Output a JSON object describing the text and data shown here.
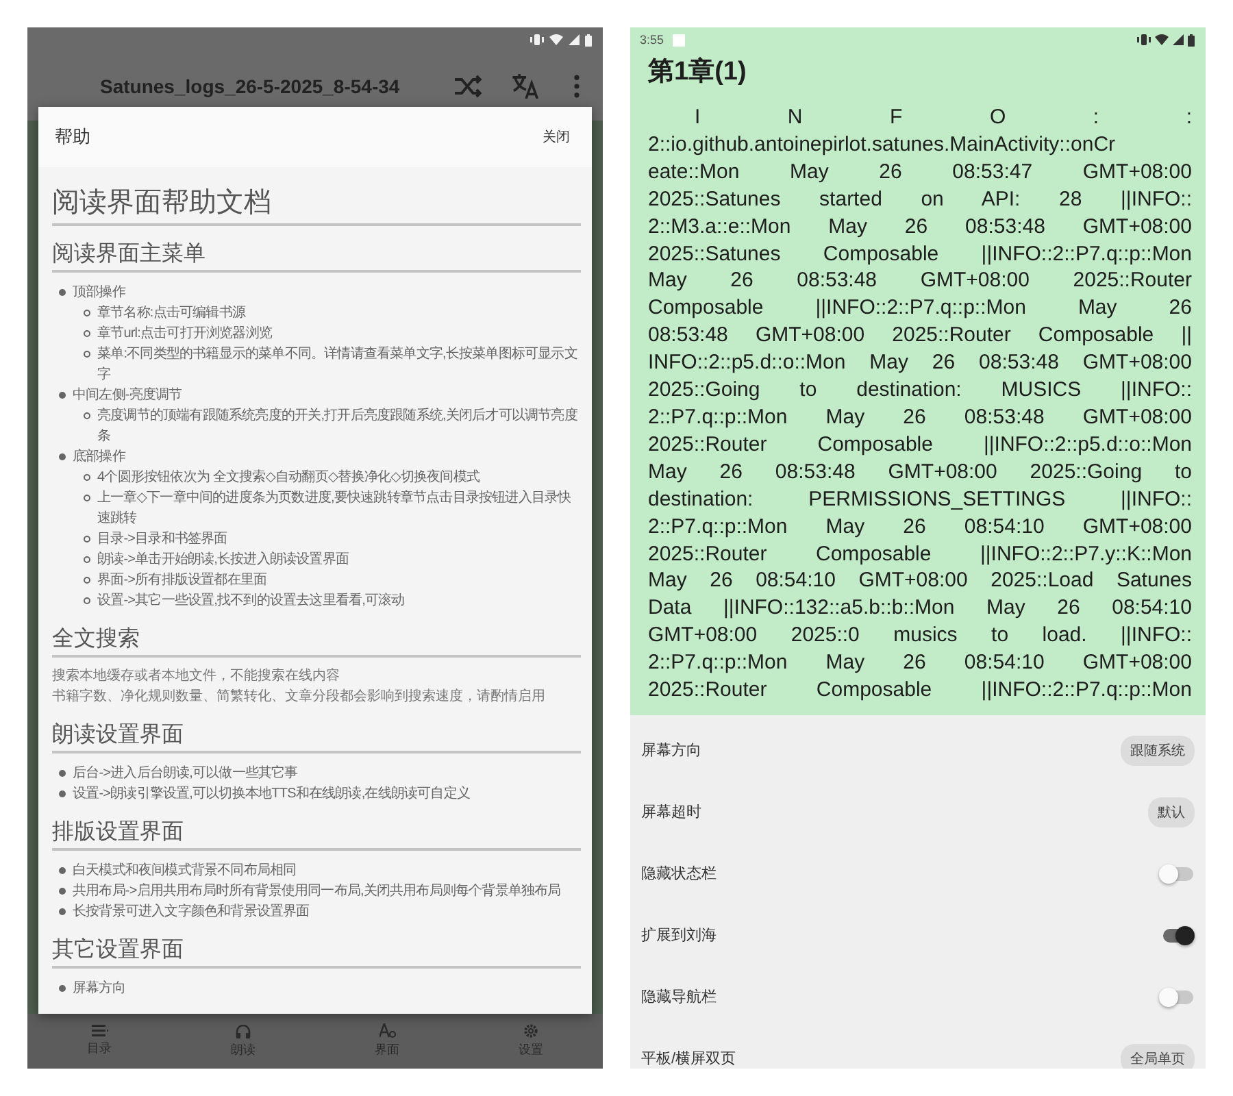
{
  "left_screen": {
    "toolbar": {
      "title": "Satunes_logs_26-5-2025_8-54-34"
    },
    "help_dialog": {
      "title": "帮助",
      "close_button": "关闭",
      "content": [
        {
          "kind": "h1",
          "text": "阅读界面帮助文档"
        },
        {
          "kind": "h2",
          "text": "阅读界面主菜单"
        },
        {
          "kind": "list",
          "items": [
            {
              "text": "顶部操作",
              "children": [
                {
                  "text": "章节名称:点击可编辑书源"
                },
                {
                  "text": "章节url:点击可打开浏览器浏览"
                },
                {
                  "text": "菜单:不同类型的书籍显示的菜单不同。详情请查看菜单文字,长按菜单图标可显示文字"
                }
              ]
            },
            {
              "text": "中间左侧-亮度调节",
              "children": [
                {
                  "text": "亮度调节的顶端有跟随系统亮度的开关,打开后亮度跟随系统,关闭后才可以调节亮度条"
                }
              ]
            },
            {
              "text": "底部操作",
              "children": [
                {
                  "text": "4个圆形按钮依次为 全文搜索◇自动翻页◇替换净化◇切换夜间模式"
                },
                {
                  "text": "上一章◇下一章中间的进度条为页数进度,要快速跳转章节点击目录按钮进入目录快速跳转"
                },
                {
                  "text": "目录->目录和书签界面"
                },
                {
                  "text": "朗读->单击开始朗读,长按进入朗读设置界面"
                },
                {
                  "text": "界面->所有排版设置都在里面"
                },
                {
                  "text": "设置->其它一些设置,找不到的设置去这里看看,可滚动"
                }
              ]
            }
          ]
        },
        {
          "kind": "h2",
          "text": "全文搜索"
        },
        {
          "kind": "paragraph",
          "text": "搜索本地缓存或者本地文件，不能搜索在线内容"
        },
        {
          "kind": "paragraph",
          "text": "书籍字数、净化规则数量、简繁转化、文章分段都会影响到搜索速度，请酌情启用"
        },
        {
          "kind": "h2",
          "text": "朗读设置界面"
        },
        {
          "kind": "list",
          "items": [
            {
              "text": "后台->进入后台朗读,可以做一些其它事"
            },
            {
              "text": "设置->朗读引擎设置,可以切换本地TTS和在线朗读,在线朗读可自定义"
            }
          ]
        },
        {
          "kind": "h2",
          "text": "排版设置界面"
        },
        {
          "kind": "list",
          "items": [
            {
              "text": "白天模式和夜间模式背景不同布局相同"
            },
            {
              "text": "共用布局->启用共用布局时所有背景使用同一布局,关闭共用布局则每个背景单独布局"
            },
            {
              "text": "长按背景可进入文字颜色和背景设置界面"
            }
          ]
        },
        {
          "kind": "h2",
          "text": "其它设置界面"
        },
        {
          "kind": "list",
          "items": [
            {
              "text": "屏幕方向"
            }
          ]
        }
      ]
    },
    "bottom_nav": [
      {
        "kind": "list",
        "label": "目录"
      },
      {
        "kind": "headphones",
        "label": "朗读"
      },
      {
        "kind": "font",
        "label": "界面"
      },
      {
        "kind": "gear",
        "label": "设置"
      }
    ]
  },
  "right_screen": {
    "status_bar": {
      "time": "3:55"
    },
    "chapter_title": "第1章(1)",
    "log_lines": [
      {
        "kind": "spread",
        "text": "I N F O : :"
      },
      {
        "text": "2::io.github.antoinepirlot.satunes.MainActivity::onCr"
      },
      {
        "text": "eate::Mon May 26 08:53:47 GMT+08:00"
      },
      {
        "text": "2025::Satunes started on API: 28 ||INFO::"
      },
      {
        "text": "2::M3.a::e::Mon May 26 08:53:48 GMT+08:00"
      },
      {
        "text": "2025::Satunes Composable ||INFO::2::P7.q::p::Mon"
      },
      {
        "text": "May 26 08:53:48 GMT+08:00 2025::Router"
      },
      {
        "text": "Composable ||INFO::2::P7.q::p::Mon May 26"
      },
      {
        "text": "08:53:48 GMT+08:00 2025::Router Composable ||"
      },
      {
        "text": "INFO::2::p5.d::o::Mon May 26 08:53:48 GMT+08:00"
      },
      {
        "text": "2025::Going to destination: MUSICS ||INFO::"
      },
      {
        "text": "2::P7.q::p::Mon May 26 08:53:48 GMT+08:00"
      },
      {
        "text": "2025::Router Composable ||INFO::2::p5.d::o::Mon"
      },
      {
        "text": "May 26 08:53:48 GMT+08:00 2025::Going to"
      },
      {
        "text": "destination: PERMISSIONS_SETTINGS ||INFO::"
      },
      {
        "text": "2::P7.q::p::Mon May 26 08:54:10 GMT+08:00"
      },
      {
        "text": "2025::Router Composable ||INFO::2::P7.y::K::Mon"
      },
      {
        "text": "May 26 08:54:10 GMT+08:00 2025::Load Satunes"
      },
      {
        "text": "Data ||INFO::132::a5.b::b::Mon May 26 08:54:10"
      },
      {
        "text": "GMT+08:00 2025::0 musics to load. ||INFO::"
      },
      {
        "text": "2::P7.q::p::Mon May 26 08:54:10 GMT+08:00"
      },
      {
        "text": "2025::Router Composable ||INFO::2::P7.q::p::Mon"
      }
    ],
    "settings": [
      {
        "kind": "chip",
        "label": "屏幕方向",
        "value": "跟随系统"
      },
      {
        "kind": "chip",
        "label": "屏幕超时",
        "value": "默认"
      },
      {
        "kind": "toggle",
        "label": "隐藏状态栏",
        "on": false
      },
      {
        "kind": "toggle",
        "label": "扩展到刘海",
        "on": true
      },
      {
        "kind": "toggle",
        "label": "隐藏导航栏",
        "on": false
      },
      {
        "kind": "chip",
        "label": "平板/横屏双页",
        "value": "全局单页"
      }
    ]
  }
}
